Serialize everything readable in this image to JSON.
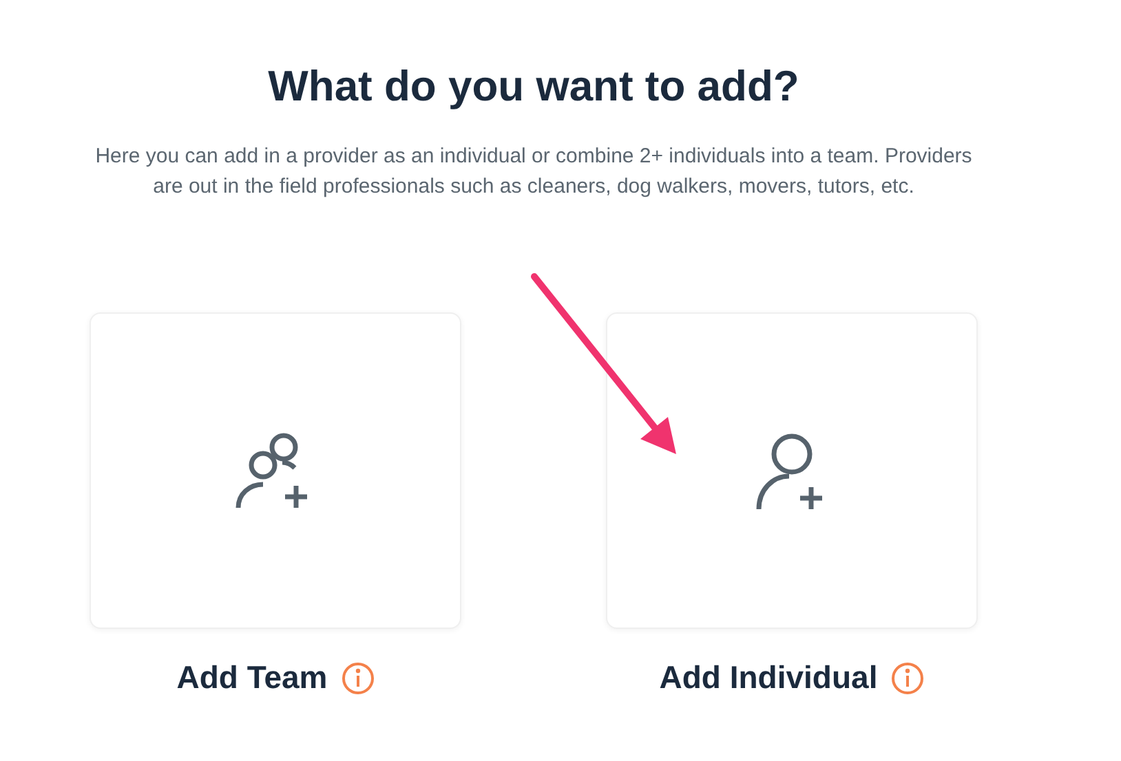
{
  "heading": "What do you want to add?",
  "description": "Here you can add in a provider as an individual or combine 2+ individuals into a team. Providers are out in the field professionals such as cleaners, dog walkers, movers, tutors, etc.",
  "options": [
    {
      "kind": "team",
      "label": "Add Team"
    },
    {
      "kind": "individual",
      "label": "Add Individual"
    }
  ],
  "annotation": {
    "kind": "arrow"
  }
}
